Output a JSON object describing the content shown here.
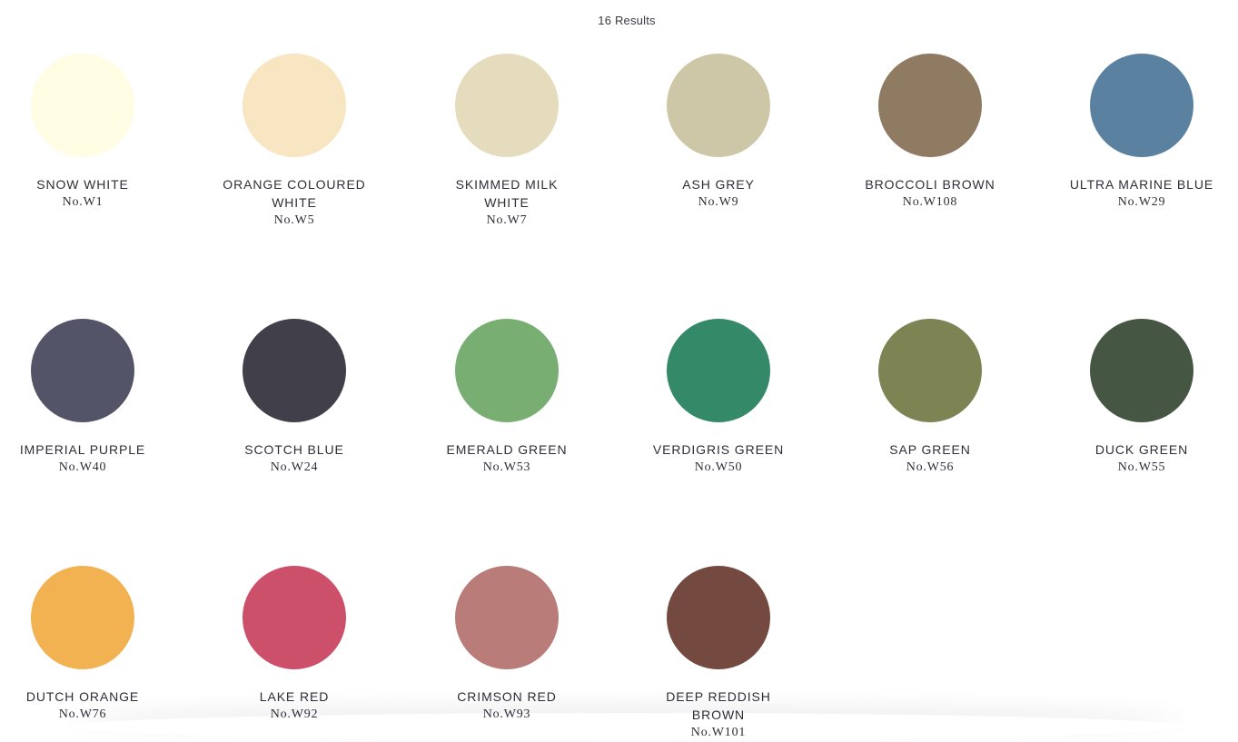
{
  "results": {
    "label": "16 Results"
  },
  "swatches": [
    {
      "name": "SNOW WHITE",
      "code": "No.W1",
      "color": "#fffde4"
    },
    {
      "name": "ORANGE COLOURED WHITE",
      "code": "No.W5",
      "color": "#f7e6c1"
    },
    {
      "name": "SKIMMED MILK WHITE",
      "code": "No.W7",
      "color": "#e5dcbd"
    },
    {
      "name": "ASH GREY",
      "code": "No.W9",
      "color": "#cdc6a7"
    },
    {
      "name": "BROCCOLI BROWN",
      "code": "No.W108",
      "color": "#8f7b62"
    },
    {
      "name": "ULTRA MARINE BLUE",
      "code": "No.W29",
      "color": "#5a82a0"
    },
    {
      "name": "IMPERIAL PURPLE",
      "code": "No.W40",
      "color": "#535468"
    },
    {
      "name": "SCOTCH BLUE",
      "code": "No.W24",
      "color": "#403f4a"
    },
    {
      "name": "EMERALD GREEN",
      "code": "No.W53",
      "color": "#79ae73"
    },
    {
      "name": "VERDIGRIS GREEN",
      "code": "No.W50",
      "color": "#348968"
    },
    {
      "name": "SAP GREEN",
      "code": "No.W56",
      "color": "#7e8353"
    },
    {
      "name": "DUCK GREEN",
      "code": "No.W55",
      "color": "#455742"
    },
    {
      "name": "DUTCH ORANGE",
      "code": "No.W76",
      "color": "#f3b251"
    },
    {
      "name": "LAKE RED",
      "code": "No.W92",
      "color": "#cc506a"
    },
    {
      "name": "CRIMSON RED",
      "code": "No.W93",
      "color": "#b97c78"
    },
    {
      "name": "DEEP REDDISH BROWN",
      "code": "No.W101",
      "color": "#744a40"
    }
  ]
}
